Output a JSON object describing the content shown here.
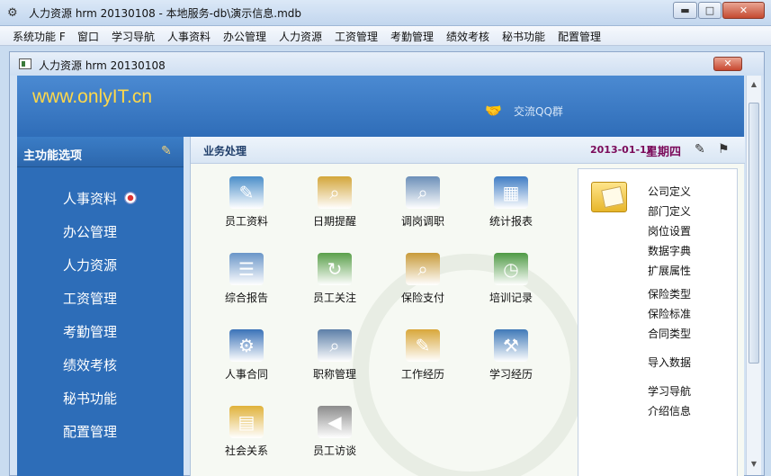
{
  "window": {
    "title": "人力资源 hrm 20130108 - 本地服务-db\\演示信息.mdb",
    "min_glyph": "▬",
    "max_glyph": "□",
    "close_glyph": "✕"
  },
  "menu": [
    "系统功能 F",
    "窗口",
    "学习导航",
    "人事资料",
    "办公管理",
    "人力资源",
    "工资管理",
    "考勤管理",
    "绩效考核",
    "秘书功能",
    "配置管理"
  ],
  "child_window": {
    "title": "人力资源 hrm 20130108",
    "close_glyph": "✕"
  },
  "banner": {
    "url": "www.onlyIT.cn",
    "qq_label": "交流QQ群"
  },
  "sidebar": {
    "header": "主功能选项",
    "items": [
      {
        "label": "人事资料"
      },
      {
        "label": "办公管理"
      },
      {
        "label": "人力资源"
      },
      {
        "label": "工资管理"
      },
      {
        "label": "考勤管理"
      },
      {
        "label": "绩效考核"
      },
      {
        "label": "秘书功能"
      },
      {
        "label": "配置管理"
      }
    ]
  },
  "work": {
    "header": "业务处理",
    "date": "2013-01-17",
    "weekday": "星期四",
    "tiles": [
      {
        "label": "员工资料",
        "icon": "edit-list-icon",
        "color": "#4a8ec9"
      },
      {
        "label": "日期提醒",
        "icon": "calendar-search-icon",
        "color": "#d3a63a"
      },
      {
        "label": "调岗调职",
        "icon": "magnifier-icon",
        "color": "#6b8fb8"
      },
      {
        "label": "统计报表",
        "icon": "calculator-icon",
        "color": "#3e7cc4"
      },
      {
        "label": "综合报告",
        "icon": "report-icon",
        "color": "#6a96c8"
      },
      {
        "label": "员工关注",
        "icon": "refresh-doc-icon",
        "color": "#5aa04a"
      },
      {
        "label": "保险支付",
        "icon": "insurance-icon",
        "color": "#c89b3a"
      },
      {
        "label": "培训记录",
        "icon": "clock-icon",
        "color": "#4e9a44"
      },
      {
        "label": "人事合同",
        "icon": "gear-refresh-icon",
        "color": "#3a72b8"
      },
      {
        "label": "职称管理",
        "icon": "screen-search-icon",
        "color": "#5c7fa8"
      },
      {
        "label": "工作经历",
        "icon": "folder-doc-icon",
        "color": "#d8a73a"
      },
      {
        "label": "学习经历",
        "icon": "gavel-icon",
        "color": "#3f79b8"
      },
      {
        "label": "社会关系",
        "icon": "folders-icon",
        "color": "#e0b23a"
      },
      {
        "label": "员工访谈",
        "icon": "megaphone-icon",
        "color": "#8c8c8c"
      }
    ],
    "links": [
      "公司定义",
      "部门定义",
      "岗位设置",
      "数据字典",
      "扩展属性",
      "保险类型",
      "保险标准",
      "合同类型",
      "导入数据",
      "学习导航",
      "介绍信息"
    ]
  }
}
